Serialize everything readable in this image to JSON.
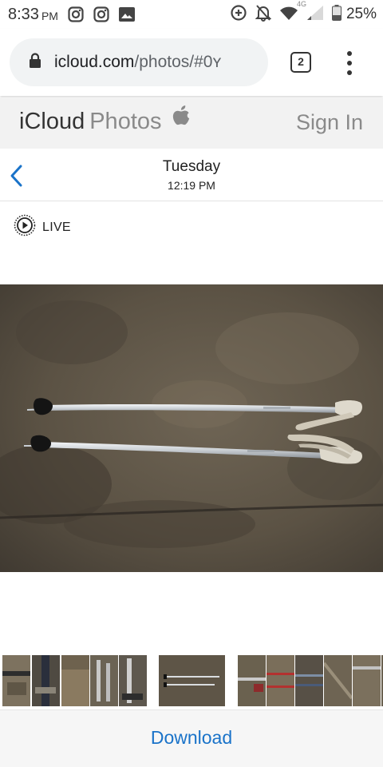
{
  "status_bar": {
    "time": "8:33",
    "ampm": "PM",
    "network": "4G",
    "battery": "25%"
  },
  "browser": {
    "url_host": "icloud.com",
    "url_path": "/photos/#0ʏ",
    "tab_count": "2"
  },
  "icloud": {
    "brand_icloud": "iCloud",
    "brand_photos": "Photos",
    "sign_in": "Sign In"
  },
  "photo_nav": {
    "day": "Tuesday",
    "time": "12:19 PM"
  },
  "live": {
    "label": "LIVE"
  },
  "toolbar": {
    "download_label": "Download"
  },
  "colors": {
    "accent_blue": "#1a73c9",
    "header_bg": "#f2f2f2",
    "toolbar_bg": "#f6f6f6"
  },
  "icons": [
    "instagram-icon",
    "gallery-icon",
    "data-saver-icon",
    "notifications-off-icon",
    "wifi-icon",
    "signal-icon",
    "battery-icon",
    "lock-icon",
    "apple-logo-icon",
    "chevron-left-icon",
    "live-photo-icon"
  ]
}
